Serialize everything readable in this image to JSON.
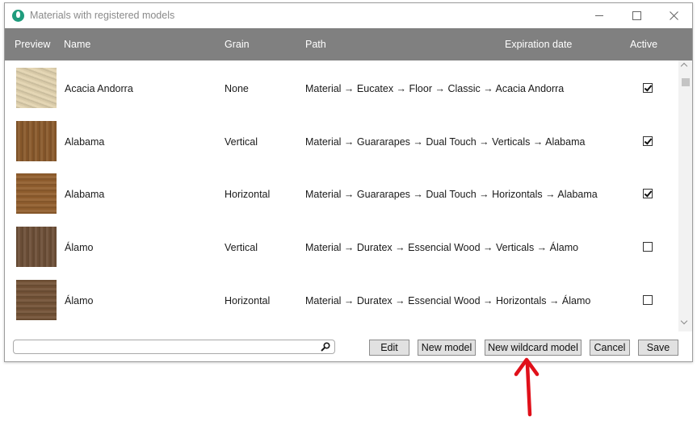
{
  "window": {
    "title": "Materials with registered models",
    "app_icon": "material-app-icon"
  },
  "grid": {
    "columns": {
      "preview": "Preview",
      "name": "Name",
      "grain": "Grain",
      "path": "Path",
      "expiration": "Expiration date",
      "active": "Active"
    },
    "rows": [
      {
        "name": "Acacia Andorra",
        "grain": "None",
        "path": "Material → Eucatex → Floor → Classic → Acacia Andorra",
        "expiration": "",
        "active": true,
        "swatch": "#e2d3b0"
      },
      {
        "name": "Alabama",
        "grain": "Vertical",
        "path": "Material → Guararapes → Dual Touch → Verticals → Alabama",
        "expiration": "",
        "active": true,
        "swatch": "#8a5a2c"
      },
      {
        "name": "Alabama",
        "grain": "Horizontal",
        "path": "Material → Guararapes → Dual Touch → Horizontals → Alabama",
        "expiration": "",
        "active": true,
        "swatch": "#93602f"
      },
      {
        "name": "Álamo",
        "grain": "Vertical",
        "path": "Material → Duratex → Essencial Wood → Verticals → Álamo",
        "expiration": "",
        "active": false,
        "swatch": "#6e5038"
      },
      {
        "name": "Álamo",
        "grain": "Horizontal",
        "path": "Material → Duratex → Essencial Wood → Horizontals → Álamo",
        "expiration": "",
        "active": false,
        "swatch": "#745337"
      }
    ]
  },
  "search": {
    "value": "",
    "placeholder": ""
  },
  "buttons": {
    "edit": "Edit",
    "new_model": "New model",
    "new_wildcard_model": "New wildcard model",
    "cancel": "Cancel",
    "save": "Save"
  },
  "colors": {
    "header_bg": "#808080",
    "annotation_arrow": "#e0101a"
  }
}
